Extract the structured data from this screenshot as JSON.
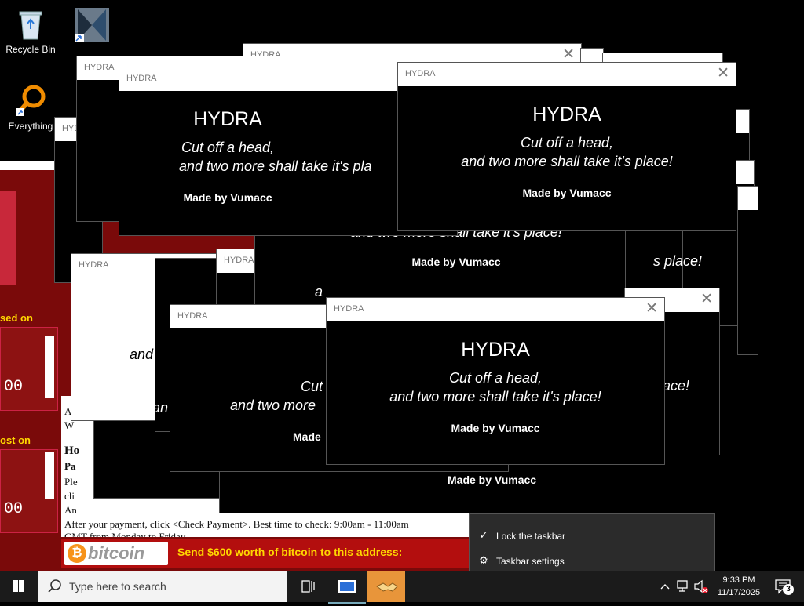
{
  "desktop": {
    "icons": [
      {
        "label": "Recycle Bin"
      },
      {
        "label": ""
      },
      {
        "label": "Everything"
      }
    ]
  },
  "ransom": {
    "label_1": "sed on",
    "label_2": "ost on",
    "counter_1": "00",
    "counter_2": "00",
    "body_lines": {
      "a": "A",
      "w": "W",
      "h": "Ho",
      "p": "Pa",
      "pl": "Ple",
      "cl": "cli",
      "an": "An",
      "after": "After your payment, click <Check Payment>. Best time to check: 9:00am - 11:00am",
      "gmt": "GMT from Monday to Friday."
    },
    "bitcoin_logo": "bitcoin",
    "send_text": "Send $600 worth of bitcoin to this address:"
  },
  "hydra": {
    "window_title": "HYDRA",
    "heading": "HYDRA",
    "line1": "Cut off a head,",
    "line2": "and two more shall take it's place!",
    "by": "Made by Vumacc",
    "frag_line2": "and two more shall take it's place!",
    "frag_place": "s place!",
    "frag_ace": "ace!",
    "frag_tw": "and t",
    "frag_an": "an",
    "frag_cut": "Cut",
    "frag_and2": "and two more",
    "frag_made": "Made",
    "frag_pla": "and two more shall take it's pla",
    "frag_a": "a"
  },
  "context_menu": {
    "items": [
      {
        "label": "Lock the taskbar",
        "icon": "check-icon"
      },
      {
        "label": "Taskbar settings",
        "icon": "gear-icon"
      }
    ]
  },
  "taskbar": {
    "search_placeholder": "Type here to search",
    "time": "9:33 PM",
    "date": "11/17/2025",
    "notification_count": "3"
  },
  "colors": {
    "ransom_red": "#7a0a0a",
    "bitcoin_orange": "#f7931a",
    "send_yellow": "#ffd700",
    "taskbar": "#1b1b1b"
  }
}
